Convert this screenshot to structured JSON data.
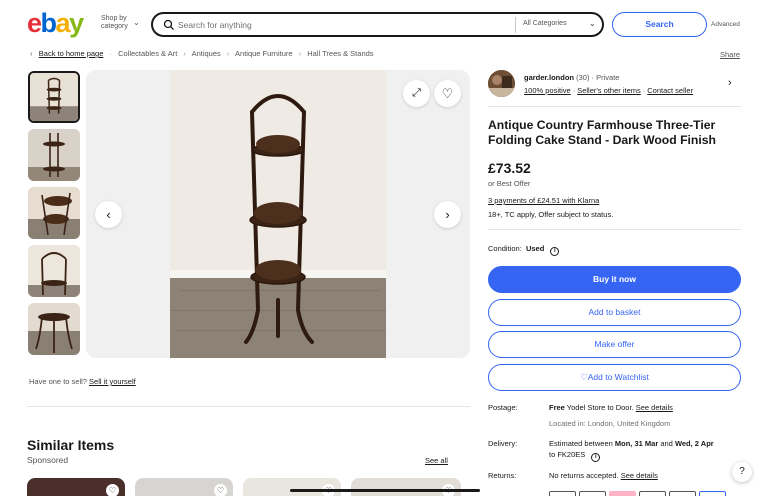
{
  "header": {
    "logo": [
      "e",
      "b",
      "a",
      "y"
    ],
    "shop_by": [
      "Shop by",
      "category"
    ],
    "search_placeholder": "Search for anything",
    "category": "All Categories",
    "search_button": "Search",
    "advanced": "Advanced"
  },
  "breadcrumb": {
    "back": "Back to home page",
    "items": [
      "Collectables & Art",
      "Antiques",
      "Antique Furniture",
      "Hall Trees & Stands"
    ],
    "share": "Share"
  },
  "gallery": {
    "have_one": "Have one to sell?",
    "sell_it": "Sell it yourself"
  },
  "similar": {
    "title": "Similar Items",
    "sponsored": "Sponsored",
    "see_all": "See all"
  },
  "seller": {
    "name": "garder.london",
    "count": "(30)",
    "type": "· Private",
    "positive": "100% positive",
    "other_items": "Seller's other items",
    "contact": "Contact seller"
  },
  "item": {
    "title": "Antique Country Farmhouse Three-Tier Folding Cake Stand - Dark Wood Finish",
    "price": "£73.52",
    "best_offer": "or Best Offer",
    "klarna": "3 payments of £24.51 with Klarna",
    "klarna_note": "18+, TC apply, Offer subject to status.",
    "condition_label": "Condition:",
    "condition_value": "Used"
  },
  "buttons": {
    "buy_now": "Buy it now",
    "add_basket": "Add to basket",
    "make_offer": "Make offer",
    "watchlist": "Add to Watchlist"
  },
  "shipping": {
    "postage_label": "Postage:",
    "postage_value": "Free",
    "postage_detail": "Yodel Store to Door.",
    "postage_link": "See details",
    "located": "Located in: London, United Kingdom",
    "delivery_label": "Delivery:",
    "delivery_pre": "Estimated between",
    "delivery_from": "Mon, 31 Mar",
    "delivery_and": "and",
    "delivery_to": "Wed, 2 Apr",
    "delivery_to_pc": "to FK20ES",
    "returns_label": "Returns:",
    "returns_value": "No returns accepted.",
    "returns_link": "See details"
  },
  "help": "?",
  "colors": {
    "brand_blue": "#3665f3",
    "wood": "#3b2416"
  }
}
